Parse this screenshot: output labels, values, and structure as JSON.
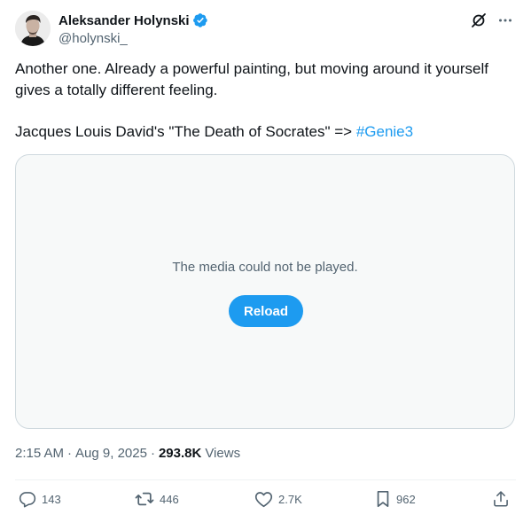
{
  "author": {
    "name": "Aleksander Holynski",
    "handle": "@holynski_"
  },
  "tweet": {
    "line1": "Another one. Already a powerful painting, but moving around it yourself gives a totally different feeling.",
    "line2_prefix": "Jacques Louis David's \"The Death of Socrates\" => ",
    "hashtag": "#Genie3"
  },
  "media": {
    "message": "The media could not be played.",
    "reload_label": "Reload"
  },
  "meta": {
    "time": "2:15 AM",
    "date": "Aug 9, 2025",
    "separator": "·",
    "views_count": "293.8K",
    "views_label": "Views"
  },
  "actions": {
    "replies": "143",
    "reposts": "446",
    "likes": "2.7K",
    "bookmarks": "962"
  },
  "colors": {
    "accent": "#1d9bf0",
    "text": "#0f1419",
    "secondary": "#536471"
  }
}
